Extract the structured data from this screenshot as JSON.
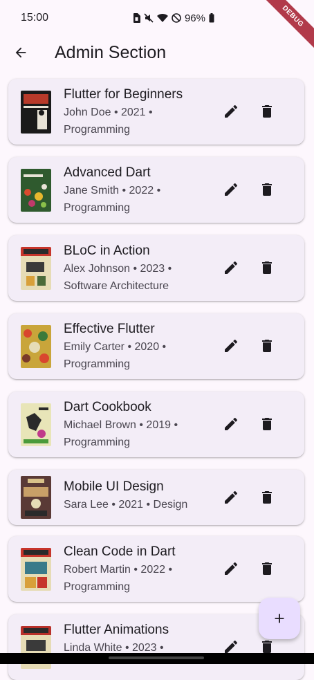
{
  "status_bar": {
    "time": "15:00",
    "battery": "96%"
  },
  "debug_banner": "DEBUG",
  "app_bar": {
    "title": "Admin Section",
    "back_icon": "arrow-back-icon"
  },
  "books": [
    {
      "title": "Flutter for Beginners",
      "subtitle": "John Doe • 2021 • Programming",
      "cover_color": "#1a1a1a"
    },
    {
      "title": "Advanced Dart",
      "subtitle": "Jane Smith • 2022 • Programming",
      "cover_color": "#2f5a2e"
    },
    {
      "title": "BLoC in Action",
      "subtitle": "Alex Johnson • 2023 • Software Architecture",
      "cover_color": "#d8c48a"
    },
    {
      "title": "Effective Flutter",
      "subtitle": "Emily Carter • 2020 • Programming",
      "cover_color": "#c9a53a"
    },
    {
      "title": "Dart Cookbook",
      "subtitle": "Michael Brown • 2019 • Programming",
      "cover_color": "#e8e5b8"
    },
    {
      "title": "Mobile UI Design",
      "subtitle": "Sara Lee • 2021 • Design",
      "cover_color": "#5a3a36"
    },
    {
      "title": "Clean Code in Dart",
      "subtitle": "Robert Martin • 2022 • Programming",
      "cover_color": "#c6352b"
    },
    {
      "title": "Flutter Animations",
      "subtitle": "Linda White • 2023 •",
      "cover_color": "#b8302a"
    }
  ],
  "actions": {
    "edit_icon": "edit-icon",
    "delete_icon": "delete-icon"
  },
  "fab": {
    "label": "+",
    "icon": "add-icon"
  },
  "colors": {
    "background": "#fdf7fd",
    "card": "#f3edf7",
    "fab": "#e9ddff",
    "icon": "#1d1b20"
  }
}
